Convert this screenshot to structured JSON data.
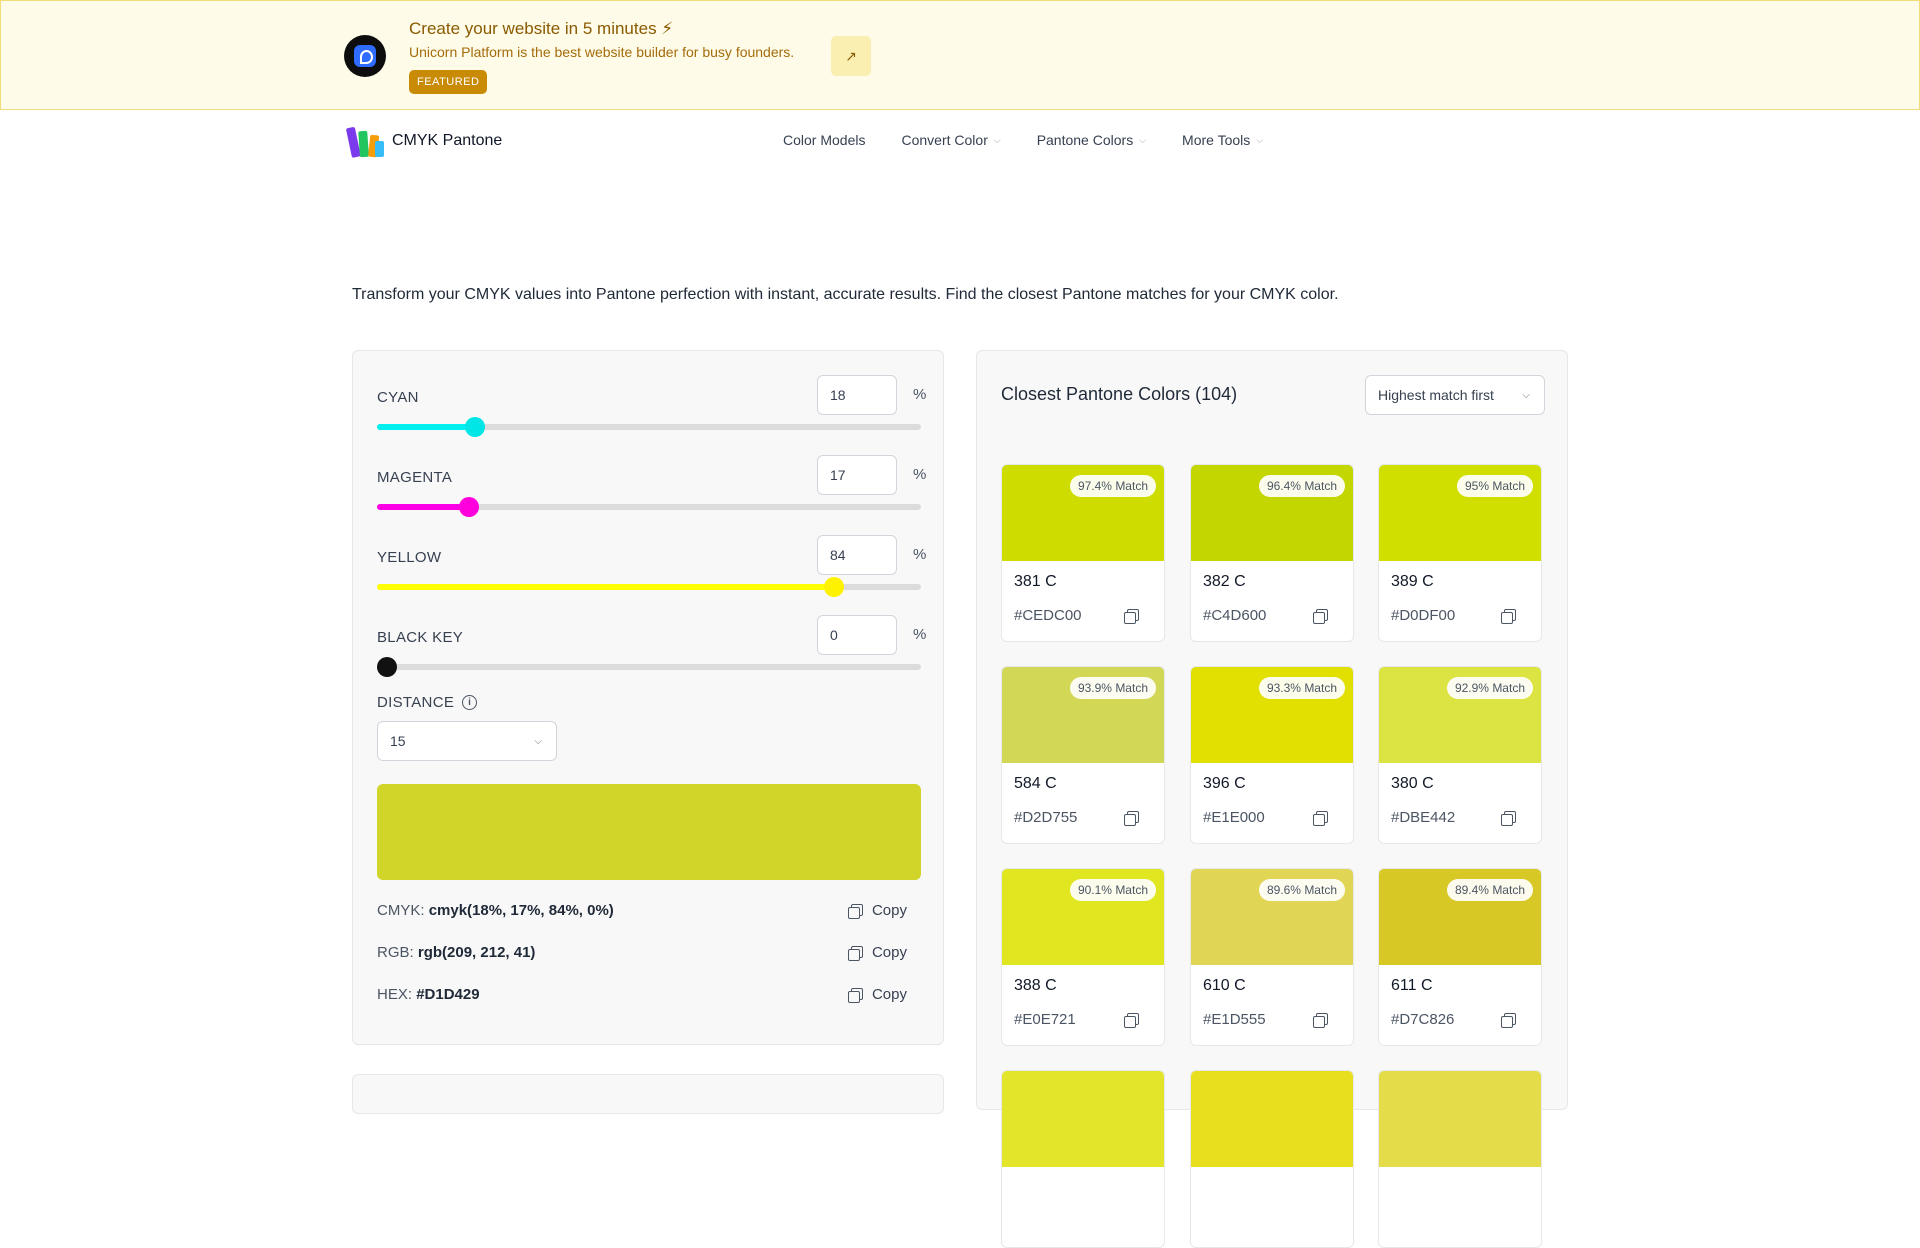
{
  "banner": {
    "title": "Create your website in 5 minutes ⚡",
    "subtitle": "Unicorn Platform is the best website builder for busy founders.",
    "badge": "FEATURED",
    "arrow": "↗"
  },
  "nav": {
    "brand": "CMYK Pantone",
    "links": [
      {
        "label": "Color Models"
      },
      {
        "label": "Convert Color"
      },
      {
        "label": "Pantone Colors"
      },
      {
        "label": "More Tools"
      }
    ]
  },
  "tagline": "Transform your CMYK values into Pantone perfection with instant, accurate results.  Find the closest Pantone matches for your CMYK color.",
  "sliders": [
    {
      "label": "CYAN",
      "value": "18",
      "unit": "%",
      "level": 18,
      "fill": "#00f0f0",
      "thumb": "#00e5e5"
    },
    {
      "label": "MAGENTA",
      "value": "17",
      "unit": "%",
      "level": 17,
      "fill": "#ff00e6",
      "thumb": "#ff00dd"
    },
    {
      "label": "YELLOW",
      "value": "84",
      "unit": "%",
      "level": 84,
      "fill": "#ffff00",
      "thumb": "#fff200"
    },
    {
      "label": "BLACK KEY",
      "value": "0",
      "unit": "%",
      "level": 0,
      "fill": "#000000",
      "thumb": "#111111"
    }
  ],
  "distance": {
    "label": "DISTANCE",
    "value": "15"
  },
  "preview_color": "#D1D429",
  "values": {
    "cmyk_label": "CMYK:",
    "cmyk": "cmyk(18%, 17%, 84%, 0%)",
    "rgb_label": "RGB:",
    "rgb": "rgb(209, 212, 41)",
    "hex_label": "HEX:",
    "hex": "#D1D429",
    "copy": "Copy"
  },
  "results": {
    "title": "Closest Pantone Colors (104)",
    "sort": "Highest match first",
    "cards": [
      {
        "name": "381 C",
        "hex": "#CEDC00",
        "match": "97.4% Match"
      },
      {
        "name": "382 C",
        "hex": "#C4D600",
        "match": "96.4% Match"
      },
      {
        "name": "389 C",
        "hex": "#D0DF00",
        "match": "95% Match"
      },
      {
        "name": "584 C",
        "hex": "#D2D755",
        "match": "93.9% Match"
      },
      {
        "name": "396 C",
        "hex": "#E1E000",
        "match": "93.3% Match"
      },
      {
        "name": "380 C",
        "hex": "#DBE442",
        "match": "92.9% Match"
      },
      {
        "name": "388 C",
        "hex": "#E0E721",
        "match": "90.1% Match"
      },
      {
        "name": "610 C",
        "hex": "#E1D555",
        "match": "89.6% Match"
      },
      {
        "name": "611 C",
        "hex": "#D7C826",
        "match": "89.4% Match"
      }
    ],
    "partial_swatches": [
      "#E3E52A",
      "#E8DF1E",
      "#E5DC4A"
    ]
  }
}
